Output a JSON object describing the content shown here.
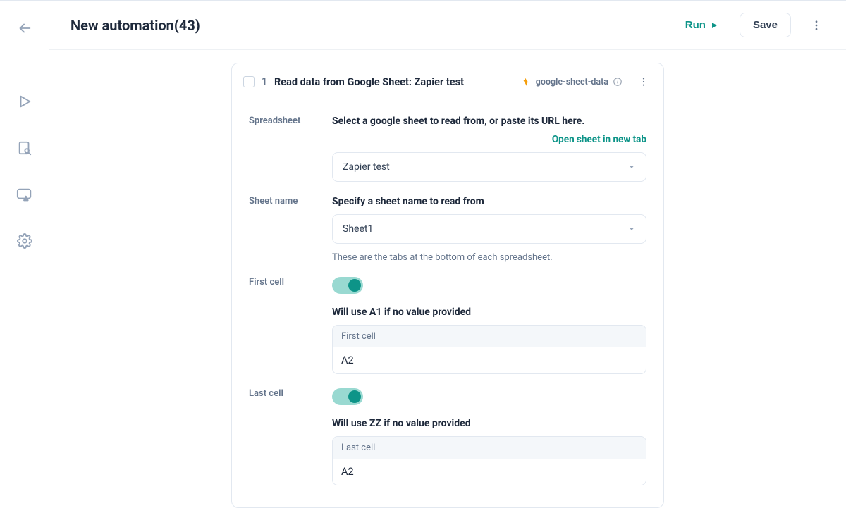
{
  "header": {
    "title": "New automation(43)",
    "run_label": "Run",
    "save_label": "Save"
  },
  "step": {
    "number": "1",
    "title": "Read data from Google Sheet: Zapier test",
    "chip": "google-sheet-data",
    "fields": {
      "spreadsheet": {
        "label": "Spreadsheet",
        "lead": "Select a google sheet to read from, or paste its URL here.",
        "open_link": "Open sheet in new tab",
        "value": "Zapier test"
      },
      "sheet_name": {
        "label": "Sheet name",
        "lead": "Specify a sheet name to read from",
        "value": "Sheet1",
        "helper": "These are the tabs at the bottom of each spreadsheet."
      },
      "first_cell": {
        "label": "First cell",
        "lead": "Will use A1 if no value provided",
        "float_label": "First cell",
        "value": "A2"
      },
      "last_cell": {
        "label": "Last cell",
        "lead": "Will use ZZ if no value provided",
        "float_label": "Last cell",
        "value": "A2"
      }
    }
  }
}
